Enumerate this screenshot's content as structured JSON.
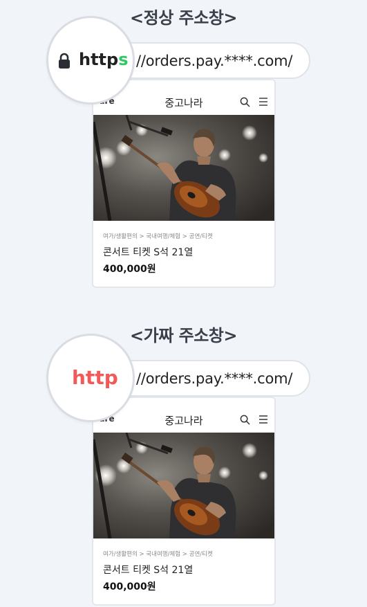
{
  "normal": {
    "heading": "<정상 주소창>",
    "scheme_main": "http",
    "scheme_s": "s",
    "url_rest": "//orders.pay.****.com/",
    "card": {
      "brand_partial": "ure",
      "store": "중고나라",
      "breadcrumb": "여가/생활편의 > 국내여행/체험 > 공연/티켓",
      "product": "콘서트 티켓 S석 21열",
      "price": "400,000원"
    }
  },
  "fake": {
    "heading": "<가짜 주소창>",
    "scheme": "http",
    "url_rest": "//orders.pay.****.com/",
    "card": {
      "brand_partial": "ure",
      "store": "중고나라",
      "breadcrumb": "여가/생활편의 > 국내여행/체험 > 공연/티켓",
      "product": "콘서트 티켓 S석 21열",
      "price": "400,000원"
    }
  },
  "colors": {
    "secure": "#2fc865",
    "insecure": "#f25a5a",
    "background": "#f1f4f8"
  }
}
